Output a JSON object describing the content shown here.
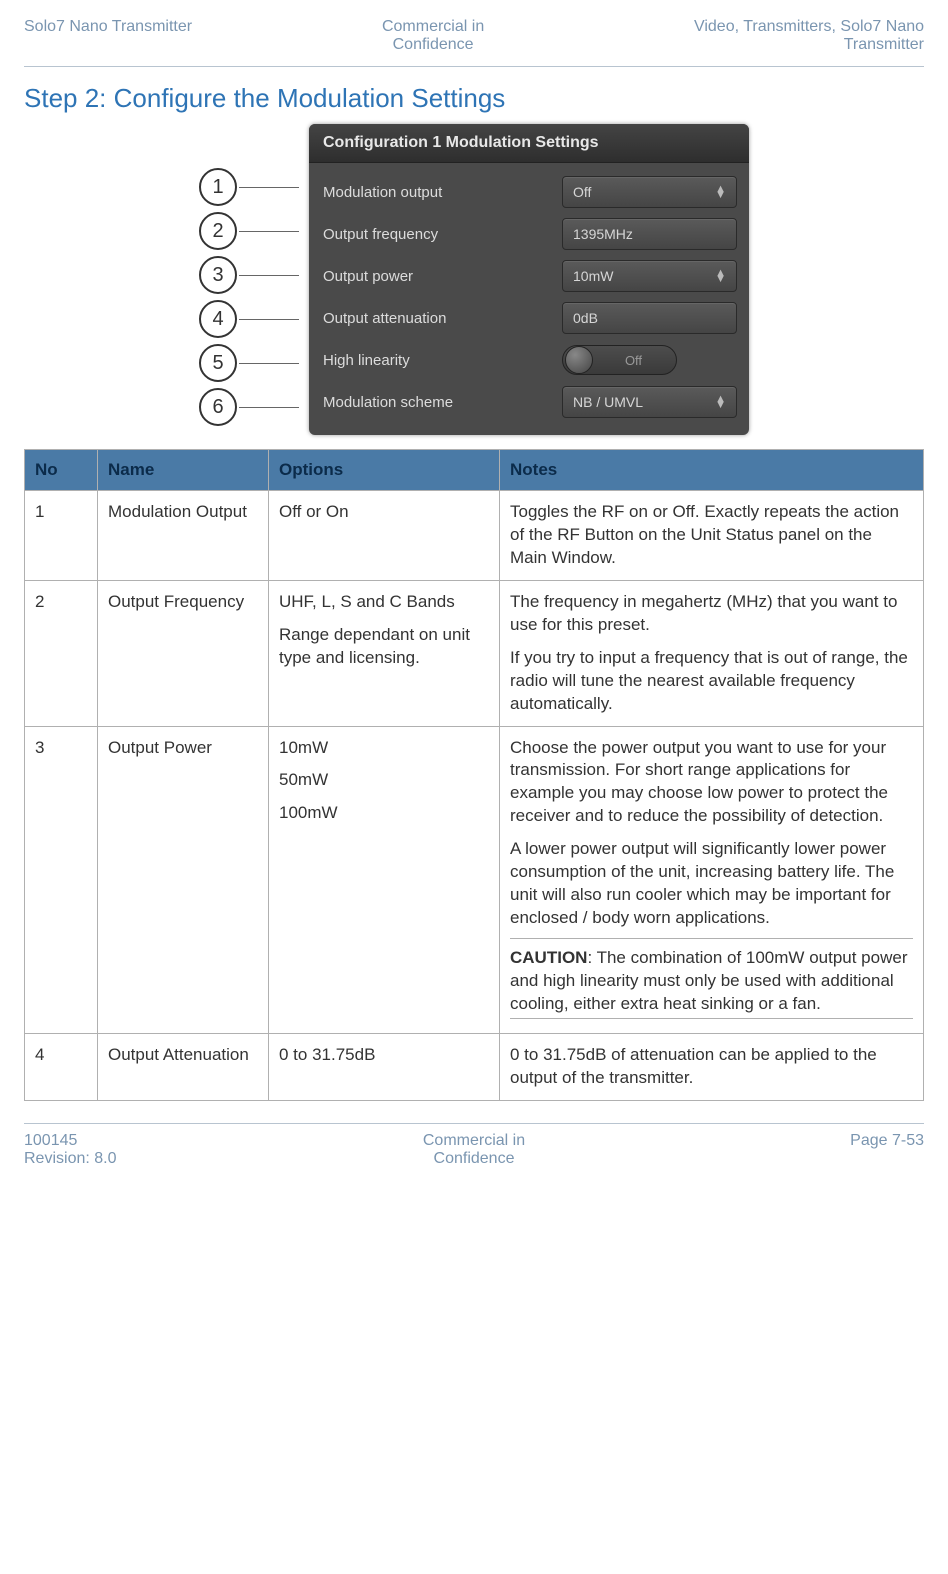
{
  "header": {
    "left": "Solo7 Nano Transmitter",
    "center_l1": "Commercial in",
    "center_l2": "Confidence",
    "right_l1": "Video, Transmitters, Solo7 Nano",
    "right_l2": "Transmitter"
  },
  "title": "Step 2: Configure the Modulation Settings",
  "panel": {
    "title": "Configuration 1 Modulation Settings",
    "rows": [
      {
        "label": "Modulation output",
        "value": "Off",
        "type": "select"
      },
      {
        "label": "Output frequency",
        "value": "1395MHz",
        "type": "input"
      },
      {
        "label": "Output power",
        "value": "10mW",
        "type": "select"
      },
      {
        "label": "Output attenuation",
        "value": "0dB",
        "type": "input"
      },
      {
        "label": "High linearity",
        "value": "Off",
        "type": "toggle"
      },
      {
        "label": "Modulation scheme",
        "value": "NB / UMVL",
        "type": "select"
      }
    ]
  },
  "callouts": [
    "1",
    "2",
    "3",
    "4",
    "5",
    "6"
  ],
  "table": {
    "headers": {
      "no": "No",
      "name": "Name",
      "options": "Options",
      "notes": "Notes"
    },
    "rows": [
      {
        "no": "1",
        "name": "Modulation Output",
        "options": [
          "Off or On"
        ],
        "notes": [
          "Toggles the RF on or Off. Exactly repeats the action of the RF Button on the Unit Status panel on the Main Window."
        ]
      },
      {
        "no": "2",
        "name": "Output Frequency",
        "options": [
          "UHF, L, S and C Bands",
          "Range dependant on unit type and licensing."
        ],
        "notes": [
          "The frequency in megahertz (MHz) that you want to use for this preset.",
          "If you try to input a frequency that is out of range, the radio will tune the nearest available frequency automatically."
        ]
      },
      {
        "no": "3",
        "name": "Output Power",
        "options": [
          "10mW",
          "50mW",
          "100mW"
        ],
        "notes": [
          "Choose the power output you want to use for your transmission. For short range applications for example you may choose low power to protect the receiver and to reduce the possibility of detection.",
          "A lower power output will significantly lower power consumption of the unit, increasing battery life. The unit will also run cooler which may be important for enclosed / body worn applications."
        ],
        "caution_label": "CAUTION",
        "caution": ": The combination of 100mW output power and high linearity must only be used with additional cooling, either extra heat sinking or a fan."
      },
      {
        "no": "4",
        "name": "Output Attenuation",
        "options": [
          "0 to 31.75dB"
        ],
        "notes": [
          "0 to 31.75dB of attenuation can be applied to the output of the transmitter."
        ]
      }
    ]
  },
  "footer": {
    "left_l1": "100145",
    "left_l2": "Revision: 8.0",
    "center_l1": "Commercial in",
    "center_l2": "Confidence",
    "right": "Page 7-53"
  }
}
